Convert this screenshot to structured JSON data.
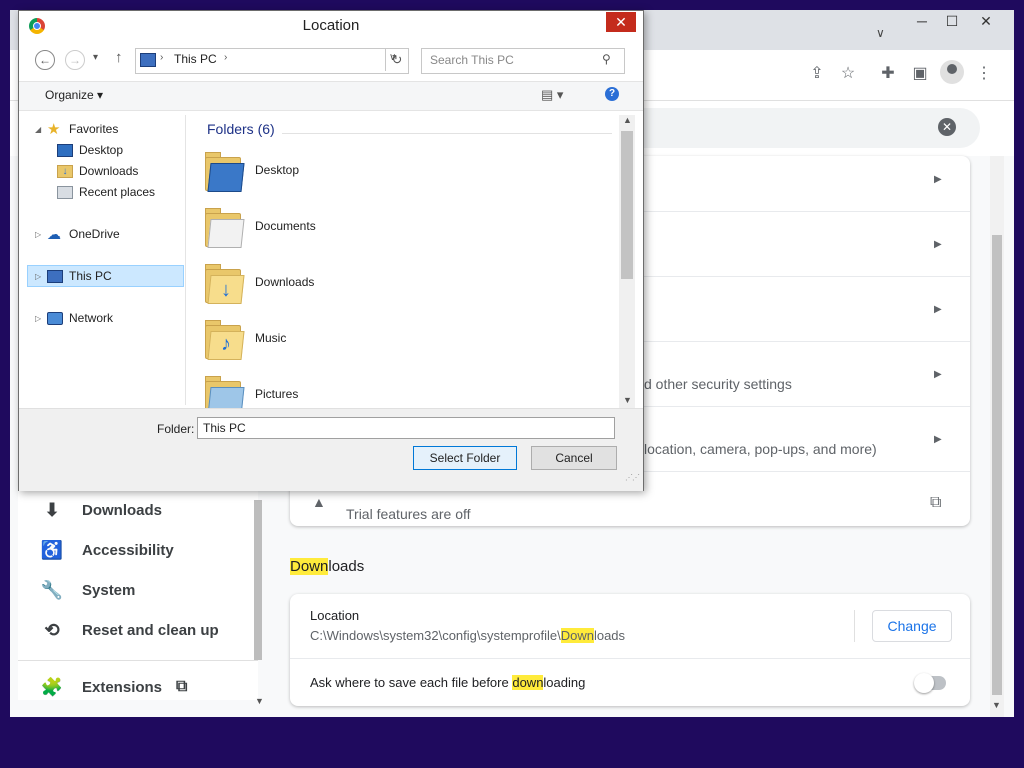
{
  "chrome": {
    "window_controls": {
      "minimize": "─",
      "maximize": "☐",
      "close": "✕"
    },
    "toolbar_icons": [
      "share-icon",
      "star-icon",
      "extensions-icon",
      "side-panel-icon",
      "profile-icon",
      "menu-icon"
    ],
    "search_clear": "✕"
  },
  "sidebar": {
    "items": [
      {
        "label": "Downloads",
        "icon": "⬇"
      },
      {
        "label": "Accessibility",
        "icon": "♿"
      },
      {
        "label": "System",
        "icon": "🔧"
      },
      {
        "label": "Reset and clean up",
        "icon": "⟲"
      },
      {
        "label": "Extensions",
        "icon": "🧩",
        "external": "⧉"
      }
    ]
  },
  "settings": {
    "visible_rows": [
      {
        "text": ""
      },
      {
        "text": ""
      },
      {
        "text": ""
      },
      {
        "text": "d other security settings"
      },
      {
        "text": "location, camera, pop-ups, and more)"
      }
    ],
    "trial_row": {
      "subtitle": "Trial features are off",
      "icon": "▲",
      "external_icon": "⧉"
    },
    "downloads": {
      "heading_highlight": "Down",
      "heading_rest": "loads",
      "location_label": "Location",
      "location_path_prefix": "C:\\Windows\\system32\\config\\systemprofile\\",
      "location_path_highlight": "Down",
      "location_path_rest": "loads",
      "change_button": "Change",
      "ask_prefix": "Ask where to save each file before ",
      "ask_highlight": "down",
      "ask_rest": "loading",
      "ask_toggle_on": false
    }
  },
  "dialog": {
    "title": "Location",
    "close": "✕",
    "nav": {
      "back": "←",
      "forward": "→",
      "recent": "▾",
      "up": "↑",
      "refresh": "↻"
    },
    "address": {
      "path": "This PC",
      "chevron": "›",
      "dropdown": "∨"
    },
    "search": {
      "placeholder": "Search This PC",
      "icon": "⚲"
    },
    "command_bar": {
      "organize": "Organize ▾",
      "view_icon": "▤ ▾",
      "help": "?"
    },
    "tree": [
      {
        "label": "Favorites",
        "expander": "◢",
        "icon": "star"
      },
      {
        "label": "Desktop",
        "expander": "",
        "icon": "desktop"
      },
      {
        "label": "Downloads",
        "expander": "",
        "icon": "downloads"
      },
      {
        "label": "Recent places",
        "expander": "",
        "icon": "recent"
      },
      {
        "label": "OneDrive",
        "expander": "▷",
        "icon": "cloud"
      },
      {
        "label": "This PC",
        "expander": "▷",
        "icon": "pc"
      },
      {
        "label": "Network",
        "expander": "▷",
        "icon": "network"
      }
    ],
    "folders_heading": "Folders (6)",
    "folders": [
      {
        "label": "Desktop",
        "overlay": "desktop"
      },
      {
        "label": "Documents",
        "overlay": "documents"
      },
      {
        "label": "Downloads",
        "overlay": "downloads"
      },
      {
        "label": "Music",
        "overlay": "music"
      },
      {
        "label": "Pictures",
        "overlay": "pictures"
      }
    ],
    "folder_field_label": "Folder:",
    "folder_field_value": "This PC",
    "select_button": "Select Folder",
    "cancel_button": "Cancel",
    "scroll": {
      "up": "▲",
      "down": "▼"
    }
  },
  "colors": {
    "desktop_background": "#1f0a5e",
    "highlight": "#ffeb3b",
    "link_blue": "#1a73e8",
    "close_red": "#c42b1c",
    "selection": "#cce8ff"
  }
}
